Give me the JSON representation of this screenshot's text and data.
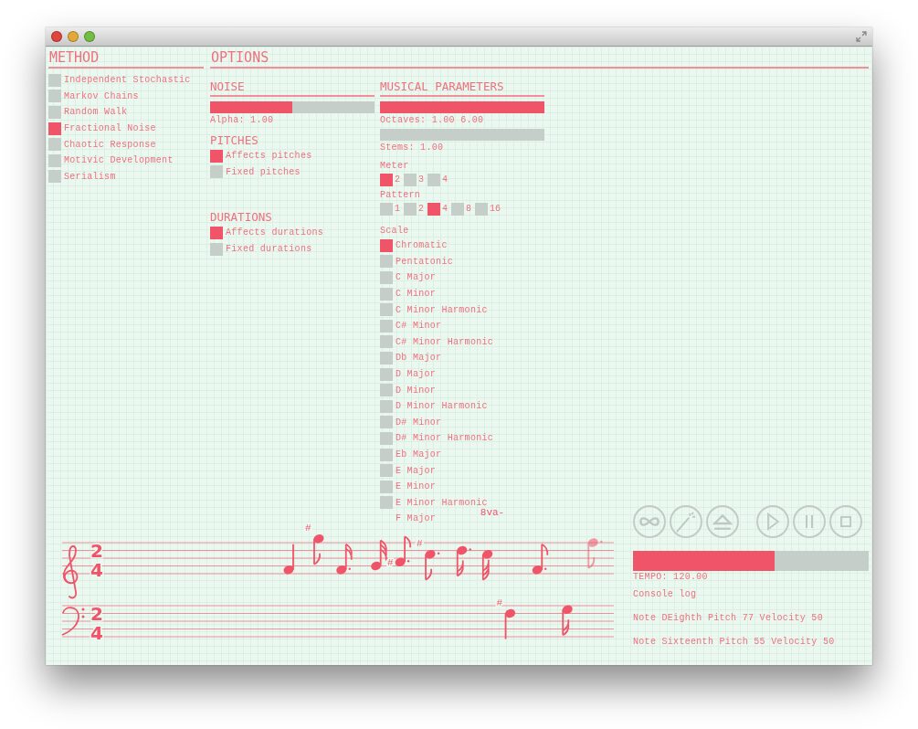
{
  "method": {
    "heading": "METHOD",
    "items": [
      {
        "label": "Independent Stochastic",
        "selected": false
      },
      {
        "label": "Markov Chains",
        "selected": false
      },
      {
        "label": "Random Walk",
        "selected": false
      },
      {
        "label": "Fractional Noise",
        "selected": true
      },
      {
        "label": "Chaotic Response",
        "selected": false
      },
      {
        "label": "Motivic Development",
        "selected": false
      },
      {
        "label": "Serialism",
        "selected": false
      }
    ]
  },
  "options": {
    "heading": "OPTIONS",
    "noise": {
      "heading": "NOISE",
      "slider": {
        "level": 0.5
      },
      "reading": "Alpha: 1.00"
    },
    "pitches": {
      "heading": "PITCHES",
      "items": [
        {
          "label": "Affects pitches",
          "selected": true
        },
        {
          "label": "Fixed pitches",
          "selected": false
        }
      ]
    },
    "durations": {
      "heading": "DURATIONS",
      "items": [
        {
          "label": "Affects durations",
          "selected": true
        },
        {
          "label": "Fixed durations",
          "selected": false
        }
      ]
    },
    "musical_parameters": {
      "heading": "MUSICAL PARAMETERS",
      "octaves": {
        "level": 1,
        "reading": "Octaves: 1.00 6.00"
      },
      "stems": {
        "level": 0,
        "reading": "Stems: 1.00"
      },
      "meter": {
        "label": "Meter",
        "items": [
          {
            "label": "2",
            "selected": true
          },
          {
            "label": "3",
            "selected": false
          },
          {
            "label": "4",
            "selected": false
          }
        ]
      },
      "pattern": {
        "label": "Pattern",
        "items": [
          {
            "label": "1",
            "selected": false
          },
          {
            "label": "2",
            "selected": false
          },
          {
            "label": "4",
            "selected": true
          },
          {
            "label": "8",
            "selected": false
          },
          {
            "label": "16",
            "selected": false
          }
        ]
      },
      "scale": {
        "label": "Scale",
        "items": [
          {
            "label": "Chromatic",
            "selected": true
          },
          {
            "label": "Pentatonic",
            "selected": false
          },
          {
            "label": "C Major",
            "selected": false
          },
          {
            "label": "C Minor",
            "selected": false
          },
          {
            "label": "C Minor Harmonic",
            "selected": false
          },
          {
            "label": "C# Minor",
            "selected": false
          },
          {
            "label": "C# Minor Harmonic",
            "selected": false
          },
          {
            "label": "Db Major",
            "selected": false
          },
          {
            "label": "D Major",
            "selected": false
          },
          {
            "label": "D Minor",
            "selected": false
          },
          {
            "label": "D Minor Harmonic",
            "selected": false
          },
          {
            "label": "D# Minor",
            "selected": false
          },
          {
            "label": "D# Minor Harmonic",
            "selected": false
          },
          {
            "label": "Eb Major",
            "selected": false
          },
          {
            "label": "E Major",
            "selected": false
          },
          {
            "label": "E Minor",
            "selected": false
          },
          {
            "label": "E Minor Harmonic",
            "selected": false
          },
          {
            "label": "F Major"
          }
        ]
      }
    }
  },
  "score": {
    "ottava": "8va-",
    "staves": [
      {
        "time": [
          "2",
          "4"
        ],
        "accidentals": [
          "#",
          "#",
          "#"
        ]
      },
      {
        "time": [
          "2",
          "4"
        ],
        "accidentals": [
          "#"
        ]
      }
    ]
  },
  "transport": {
    "tools": [
      {
        "kind": "loop"
      },
      {
        "kind": "wand"
      },
      {
        "kind": "eject"
      }
    ],
    "playback": [
      {
        "kind": "play"
      },
      {
        "kind": "pause"
      },
      {
        "kind": "stop"
      }
    ]
  },
  "tempo": {
    "level": 0.6,
    "reading": "TEMPO: 120.00"
  },
  "console": {
    "title": "Console log",
    "lines": [
      "Note DEighth Pitch 77 Velocity 50",
      "Note Sixteenth Pitch 55 Velocity 50"
    ]
  }
}
